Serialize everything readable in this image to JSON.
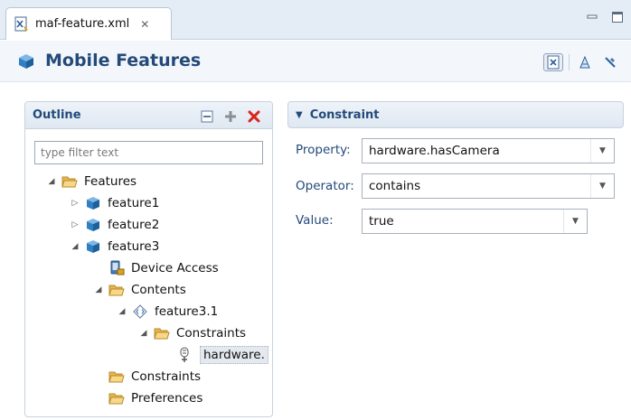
{
  "tab": {
    "label": "maf-feature.xml",
    "close": "✕"
  },
  "header": {
    "title": "Mobile Features"
  },
  "outline": {
    "title": "Outline",
    "filter_placeholder": "type filter text",
    "tree": [
      {
        "label": "Features",
        "icon": "folder-open-icon",
        "toggle": "expanded"
      },
      {
        "label": "feature1",
        "icon": "feature-cube-icon",
        "toggle": "collapsed"
      },
      {
        "label": "feature2",
        "icon": "feature-cube-icon",
        "toggle": "collapsed"
      },
      {
        "label": "feature3",
        "icon": "feature-cube-icon",
        "toggle": "expanded"
      },
      {
        "label": "Device Access",
        "icon": "device-access-icon",
        "toggle": "none"
      },
      {
        "label": "Contents",
        "icon": "folder-open-icon",
        "toggle": "expanded"
      },
      {
        "label": "feature3.1",
        "icon": "content-xml-icon",
        "toggle": "expanded"
      },
      {
        "label": "Constraints",
        "icon": "folder-open-icon",
        "toggle": "expanded"
      },
      {
        "label": "hardware.",
        "icon": "constraint-icon",
        "toggle": "none",
        "selected": true
      },
      {
        "label": "Constraints",
        "icon": "folder-open-icon",
        "toggle": "none"
      },
      {
        "label": "Preferences",
        "icon": "folder-open-icon",
        "toggle": "none"
      }
    ]
  },
  "constraint": {
    "title": "Constraint",
    "property_label": "Property:",
    "property_value": "hardware.hasCamera",
    "operator_label": "Operator:",
    "operator_value": "contains",
    "value_label": "Value:",
    "value_value": "true"
  },
  "colors": {
    "title_blue": "#234a7a",
    "feature_blue": "#2f7fc4",
    "folder_yellow": "#f3c86a",
    "delete_red": "#d9261c"
  }
}
